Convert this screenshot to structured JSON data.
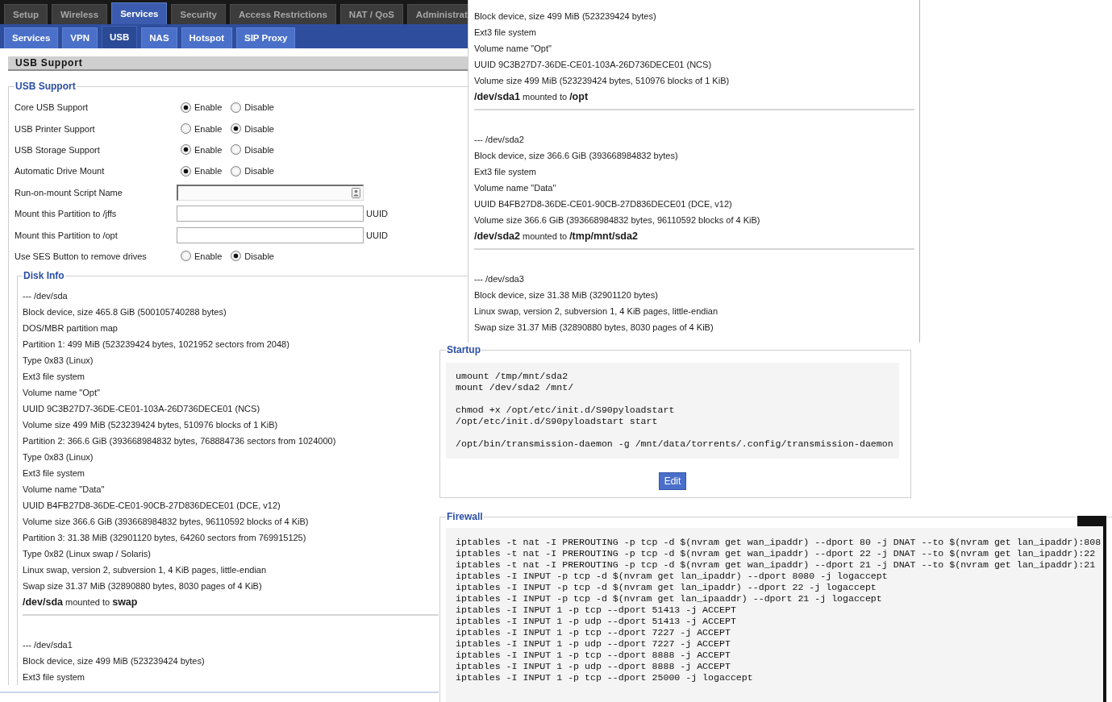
{
  "usb_page": {
    "main_tabs": [
      {
        "label": "Setup",
        "selected": false
      },
      {
        "label": "Wireless",
        "selected": false
      },
      {
        "label": "Services",
        "selected": true
      },
      {
        "label": "Security",
        "selected": false
      },
      {
        "label": "Access Restrictions",
        "selected": false
      },
      {
        "label": "NAT / QoS",
        "selected": false
      },
      {
        "label": "Administrat",
        "selected": false
      }
    ],
    "sub_tabs": [
      {
        "label": "Services",
        "selected": false
      },
      {
        "label": "VPN",
        "selected": false
      },
      {
        "label": "USB",
        "selected": true
      },
      {
        "label": "NAS",
        "selected": false
      },
      {
        "label": "Hotspot",
        "selected": false
      },
      {
        "label": "SIP Proxy",
        "selected": false
      }
    ],
    "section_title": "USB Support",
    "usb_support": {
      "legend": "USB Support",
      "rows": [
        {
          "kind": "radio",
          "label": "Core USB Support",
          "options": [
            {
              "label": "Enable",
              "selected": true
            },
            {
              "label": "Disable",
              "selected": false
            }
          ]
        },
        {
          "kind": "radio",
          "label": "USB Printer Support",
          "options": [
            {
              "label": "Enable",
              "selected": false
            },
            {
              "label": "Disable",
              "selected": true
            }
          ]
        },
        {
          "kind": "radio",
          "label": "USB Storage Support",
          "options": [
            {
              "label": "Enable",
              "selected": true
            },
            {
              "label": "Disable",
              "selected": false
            }
          ]
        },
        {
          "kind": "radio",
          "label": "Automatic Drive Mount",
          "options": [
            {
              "label": "Enable",
              "selected": true
            },
            {
              "label": "Disable",
              "selected": false
            }
          ]
        },
        {
          "kind": "file",
          "label": "Run-on-mount Script Name"
        },
        {
          "kind": "text",
          "label": "Mount this Partition to /jffs",
          "suffix": "UUID"
        },
        {
          "kind": "text",
          "label": "Mount this Partition to /opt",
          "suffix": "UUID"
        },
        {
          "kind": "radio",
          "label": "Use SES Button to remove drives",
          "options": [
            {
              "label": "Enable",
              "selected": false
            },
            {
              "label": "Disable",
              "selected": true
            }
          ]
        }
      ]
    },
    "disk_info": {
      "legend": "Disk Info",
      "blocks": [
        {
          "lines": [
            "--- /dev/sda",
            "Block device, size 465.8 GiB (500105740288 bytes)",
            "DOS/MBR partition map",
            "Partition 1: 499 MiB (523239424 bytes, 1021952 sectors from 2048)",
            "Type 0x83 (Linux)",
            "Ext3 file system",
            "Volume name \"Opt\"",
            "UUID 9C3B27D7-36DE-CE01-103A-26D736DECE01 (NCS)",
            "Volume size 499 MiB (523239424 bytes, 510976 blocks of 1 KiB)",
            "Partition 2: 366.6 GiB (393668984832 bytes, 768884736 sectors from 1024000)",
            "Type 0x83 (Linux)",
            "Ext3 file system",
            "Volume name \"Data\"",
            "UUID B4FB27D8-36DE-CE01-90CB-27D836DECE01 (DCE, v12)",
            "Volume size 366.6 GiB (393668984832 bytes, 96110592 blocks of 4 KiB)",
            "Partition 3: 31.38 MiB (32901120 bytes, 64260 sectors from 769915125)",
            "Type 0x82 (Linux swap / Solaris)",
            "Linux swap, version 2, subversion 1, 4 KiB pages, little-endian",
            "Swap size 31.37 MiB (32890880 bytes, 8030 pages of 4 KiB)"
          ],
          "mount": "**/dev/sda** mounted to **swap**"
        },
        {
          "lines": [
            "--- /dev/sda1",
            "Block device, size 499 MiB (523239424 bytes)",
            "Ext3 file system"
          ]
        }
      ]
    }
  },
  "disk_info_continued": {
    "blocks": [
      {
        "lines": [
          "Block device, size 499 MiB (523239424 bytes)",
          "Ext3 file system",
          "Volume name \"Opt\"",
          "UUID 9C3B27D7-36DE-CE01-103A-26D736DECE01 (NCS)",
          "Volume size 499 MiB (523239424 bytes, 510976 blocks of 1 KiB)"
        ],
        "mount": "**/dev/sda1** mounted to **/opt**"
      },
      {
        "lines": [
          "--- /dev/sda2",
          "Block device, size 366.6 GiB (393668984832 bytes)",
          "Ext3 file system",
          "Volume name \"Data\"",
          "UUID B4FB27D8-36DE-CE01-90CB-27D836DECE01 (DCE, v12)",
          "Volume size 366.6 GiB (393668984832 bytes, 96110592 blocks of 4 KiB)"
        ],
        "mount": "**/dev/sda2** mounted to **/tmp/mnt/sda2**"
      },
      {
        "lines": [
          "--- /dev/sda3",
          "Block device, size 31.38 MiB (32901120 bytes)",
          "Linux swap, version 2, subversion 1, 4 KiB pages, little-endian",
          "Swap size 31.37 MiB (32890880 bytes, 8030 pages of 4 KiB)"
        ]
      }
    ]
  },
  "services_page": {
    "startup": {
      "legend": "Startup",
      "code_groups": [
        [
          "umount /tmp/mnt/sda2",
          "mount /dev/sda2 /mnt/"
        ],
        [
          "chmod +x /opt/etc/init.d/S90pyloadstart",
          "/opt/etc/init.d/S90pyloadstart start"
        ],
        [
          "/opt/bin/transmission-daemon -g /mnt/data/torrents/.config/transmission-daemon"
        ]
      ],
      "button": "Edit"
    },
    "firewall": {
      "legend": "Firewall",
      "code": [
        "iptables -t nat -I PREROUTING -p tcp -d $(nvram get wan_ipaddr) --dport 80 -j DNAT --to $(nvram get lan_ipaddr):808",
        "iptables -t nat -I PREROUTING -p tcp -d $(nvram get wan_ipaddr) --dport 22 -j DNAT --to $(nvram get lan_ipaddr):22",
        "iptables -t nat -I PREROUTING -p tcp -d $(nvram get wan_ipaddr) --dport 21 -j DNAT --to $(nvram get lan_ipaddr):21",
        "iptables -I INPUT -p tcp -d $(nvram get lan_ipaddr) --dport 8080 -j logaccept",
        "iptables -I INPUT -p tcp -d $(nvram get lan_ipaddr) --dport 22 -j logaccept",
        "iptables -I INPUT -p tcp -d $(nvram get lan_ipaaddr) --dport 21 -j logaccept",
        "iptables -I INPUT 1 -p tcp --dport 51413 -j ACCEPT",
        "iptables -I INPUT 1 -p udp --dport 51413 -j ACCEPT",
        "iptables -I INPUT 1 -p tcp --dport 7227 -j ACCEPT",
        "iptables -I INPUT 1 -p udp --dport 7227 -j ACCEPT",
        "iptables -I INPUT 1 -p tcp --dport 8888 -j ACCEPT",
        "iptables -I INPUT 1 -p udp --dport 8888 -j ACCEPT",
        "iptables -I INPUT 1 -p tcp --dport 25000 -j logaccept"
      ]
    }
  }
}
